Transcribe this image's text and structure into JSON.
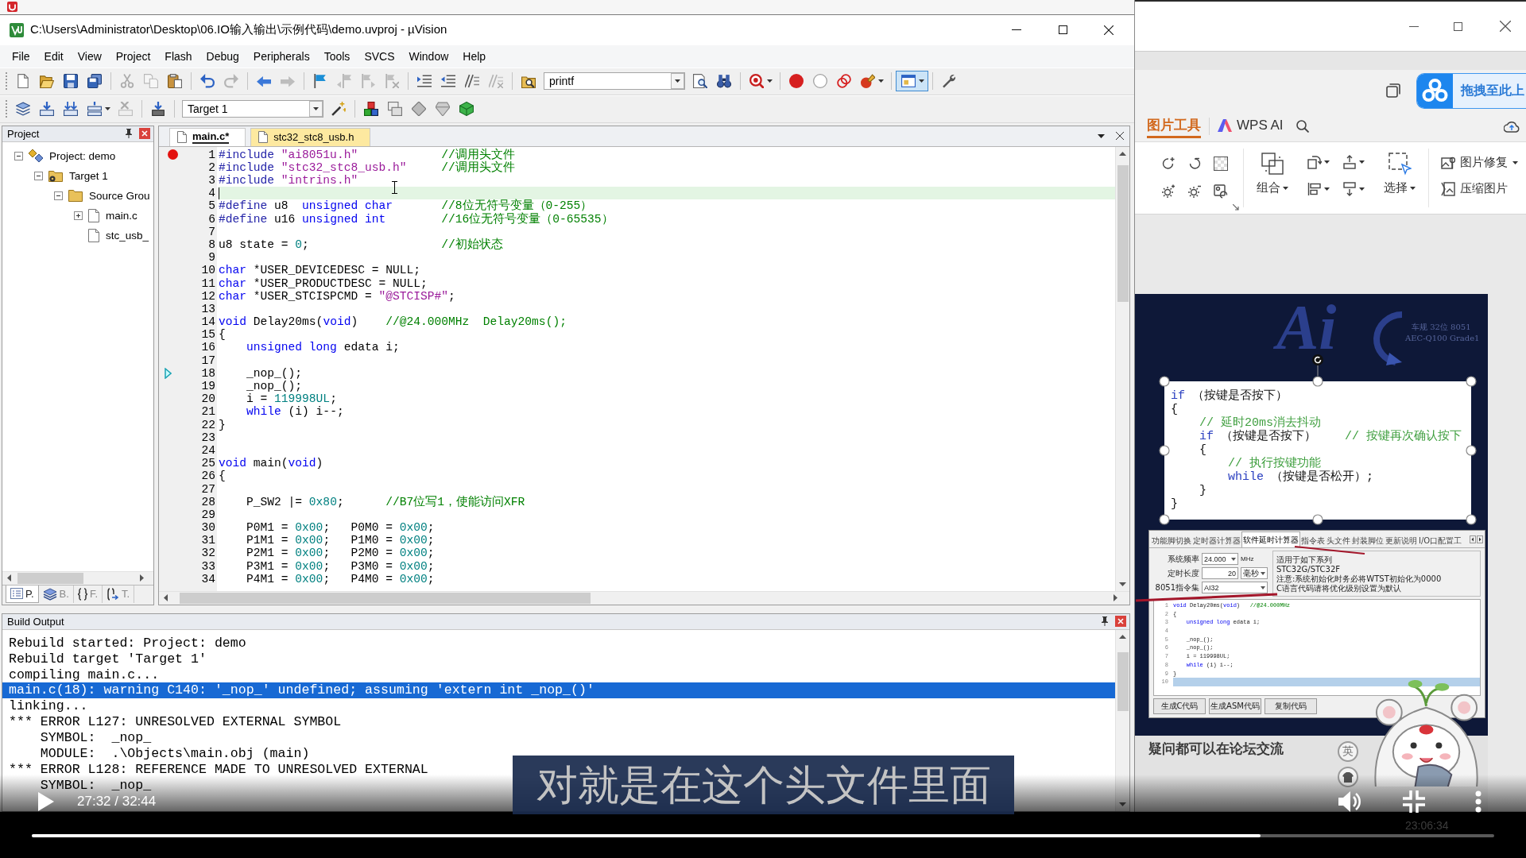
{
  "uvision": {
    "title": "C:\\Users\\Administrator\\Desktop\\06.IO输入输出\\示例代码\\demo.uvproj - µVision",
    "menu": [
      "File",
      "Edit",
      "View",
      "Project",
      "Flash",
      "Debug",
      "Peripherals",
      "Tools",
      "SVCS",
      "Window",
      "Help"
    ],
    "toolbars": [
      {
        "items": [
          {
            "kind": "new-file",
            "disabled": false
          },
          {
            "kind": "open",
            "disabled": false
          },
          {
            "kind": "save",
            "disabled": false
          },
          {
            "kind": "save-all",
            "disabled": false
          },
          {
            "kind": "separator"
          },
          {
            "kind": "cut",
            "disabled": true
          },
          {
            "kind": "copy",
            "disabled": true
          },
          {
            "kind": "paste",
            "disabled": false
          },
          {
            "kind": "separator"
          },
          {
            "kind": "undo",
            "disabled": false
          },
          {
            "kind": "redo",
            "disabled": true
          },
          {
            "kind": "separator"
          },
          {
            "kind": "back",
            "disabled": false
          },
          {
            "kind": "forward",
            "disabled": true
          },
          {
            "kind": "separator"
          },
          {
            "kind": "bookmark",
            "disabled": false
          },
          {
            "kind": "prev-bookmark",
            "disabled": true
          },
          {
            "kind": "next-bookmark",
            "disabled": true
          },
          {
            "kind": "clear-bookmarks",
            "disabled": true
          },
          {
            "kind": "separator"
          },
          {
            "kind": "indent",
            "disabled": false
          },
          {
            "kind": "unindent",
            "disabled": false
          },
          {
            "kind": "comment",
            "disabled": false
          },
          {
            "kind": "uncomment",
            "disabled": true
          },
          {
            "kind": "separator"
          },
          {
            "kind": "find-files",
            "disabled": false
          },
          {
            "kind": "combo",
            "value": "printf"
          },
          {
            "kind": "find",
            "disabled": false
          },
          {
            "kind": "incremental-find",
            "disabled": false
          },
          {
            "kind": "separator"
          },
          {
            "kind": "debug",
            "disabled": false,
            "dropdown": true
          },
          {
            "kind": "separator"
          },
          {
            "kind": "breakpoint",
            "disabled": false
          },
          {
            "kind": "breakpoint-enable",
            "disabled": false
          },
          {
            "kind": "breakpoints-disable",
            "disabled": false
          },
          {
            "kind": "breakpoints-kill",
            "disabled": false,
            "dropdown": true
          },
          {
            "kind": "separator"
          },
          {
            "kind": "layout",
            "disabled": false,
            "dropdown": true,
            "pressed": true
          },
          {
            "kind": "separator"
          },
          {
            "kind": "configure",
            "disabled": false
          }
        ]
      },
      {
        "items": [
          {
            "kind": "translate",
            "disabled": false
          },
          {
            "kind": "build",
            "disabled": false
          },
          {
            "kind": "rebuild",
            "disabled": false
          },
          {
            "kind": "batch-build",
            "disabled": false,
            "dropdown": true
          },
          {
            "kind": "stop-build",
            "disabled": true
          },
          {
            "kind": "separator"
          },
          {
            "kind": "download",
            "disabled": false
          },
          {
            "kind": "separator"
          },
          {
            "kind": "combo",
            "value": "Target 1"
          },
          {
            "kind": "target-options",
            "disabled": false
          },
          {
            "kind": "separator"
          },
          {
            "kind": "manage-items",
            "disabled": false
          },
          {
            "kind": "components",
            "disabled": false
          },
          {
            "kind": "select-packs",
            "disabled": false
          },
          {
            "kind": "pack-tools",
            "disabled": false
          },
          {
            "kind": "pack-installer",
            "disabled": false
          }
        ]
      }
    ],
    "project": {
      "title": "Project",
      "tree": [
        {
          "label": "Project: demo",
          "kind": "project",
          "expanded": true,
          "children": [
            {
              "label": "Target 1",
              "kind": "target",
              "expanded": true,
              "children": [
                {
                  "label": "Source Grou",
                  "kind": "folder",
                  "expanded": true,
                  "children": [
                    {
                      "label": "main.c",
                      "kind": "file",
                      "expanded": false
                    },
                    {
                      "label": "stc_usb_",
                      "kind": "file"
                    }
                  ]
                }
              ]
            }
          ]
        }
      ],
      "tabs": [
        {
          "label": "P.",
          "kind": "project",
          "selected": true
        },
        {
          "label": "B.",
          "kind": "books",
          "selected": false
        },
        {
          "label": "F.",
          "kind": "functions",
          "selected": false
        },
        {
          "label": "T.",
          "kind": "templates",
          "selected": false
        }
      ]
    },
    "editor": {
      "tabs": [
        {
          "label": "main.c*",
          "selected": true
        },
        {
          "label": "stc32_stc8_usb.h",
          "selected": false
        }
      ],
      "lines": [
        {
          "number": "1",
          "kind": "breakpoint",
          "current": false,
          "tokens": [
            {
              "kind": "directive",
              "text": "#include"
            },
            {
              "kind": "string",
              "text": " \"ai8051u.h\""
            },
            {
              "kind": "comment",
              "text": "            //调用头文件"
            }
          ]
        },
        {
          "number": "2",
          "kind": "plain",
          "current": false,
          "tokens": [
            {
              "kind": "directive",
              "text": "#include"
            },
            {
              "kind": "string",
              "text": " \"stc32_stc8_usb.h\""
            },
            {
              "kind": "comment",
              "text": "     //调用头文件"
            }
          ]
        },
        {
          "number": "3",
          "kind": "plain",
          "current": false,
          "tokens": [
            {
              "kind": "directive",
              "text": "#include"
            },
            {
              "kind": "string",
              "text": " \"intrins.h\""
            }
          ]
        },
        {
          "number": "4",
          "kind": "plain",
          "current": true
        },
        {
          "number": "5",
          "kind": "plain",
          "current": false,
          "tokens": [
            {
              "kind": "directive",
              "text": "#define"
            },
            {
              "kind": "plain",
              "text": " u8  "
            },
            {
              "kind": "keyword",
              "text": "unsigned char"
            },
            {
              "kind": "comment",
              "text": "       //8位无符号变量（0-255）"
            }
          ]
        },
        {
          "number": "6",
          "kind": "plain",
          "current": false,
          "tokens": [
            {
              "kind": "directive",
              "text": "#define"
            },
            {
              "kind": "plain",
              "text": " u16 "
            },
            {
              "kind": "keyword",
              "text": "unsigned int"
            },
            {
              "kind": "comment",
              "text": "        //16位无符号变量（0-65535）"
            }
          ]
        },
        {
          "number": "7",
          "kind": "plain",
          "current": false
        },
        {
          "number": "8",
          "kind": "plain",
          "current": false,
          "tokens": [
            {
              "kind": "plain",
              "text": "u8 state = "
            },
            {
              "kind": "number",
              "text": "0"
            },
            {
              "kind": "plain",
              "text": ";"
            },
            {
              "kind": "comment",
              "text": "                   //初始状态"
            }
          ]
        },
        {
          "number": "9",
          "kind": "plain",
          "current": false
        },
        {
          "number": "10",
          "kind": "plain",
          "current": false,
          "tokens": [
            {
              "kind": "keyword",
              "text": "char"
            },
            {
              "kind": "plain",
              "text": " *USER_DEVICEDESC = NULL;"
            }
          ]
        },
        {
          "number": "11",
          "kind": "plain",
          "current": false,
          "tokens": [
            {
              "kind": "keyword",
              "text": "char"
            },
            {
              "kind": "plain",
              "text": " *USER_PRODUCTDESC = NULL;"
            }
          ]
        },
        {
          "number": "12",
          "kind": "plain",
          "current": false,
          "tokens": [
            {
              "kind": "keyword",
              "text": "char"
            },
            {
              "kind": "plain",
              "text": " *USER_STCISPCMD = "
            },
            {
              "kind": "string",
              "text": "\"@STCISP#\""
            },
            {
              "kind": "plain",
              "text": ";"
            }
          ]
        },
        {
          "number": "13",
          "kind": "plain",
          "current": false
        },
        {
          "number": "14",
          "kind": "plain",
          "current": false,
          "tokens": [
            {
              "kind": "keyword",
              "text": "void"
            },
            {
              "kind": "plain",
              "text": " Delay20ms("
            },
            {
              "kind": "keyword",
              "text": "void"
            },
            {
              "kind": "plain",
              "text": ")"
            },
            {
              "kind": "comment",
              "text": "    //@24.000MHz  Delay20ms();"
            }
          ]
        },
        {
          "number": "15",
          "kind": "plain",
          "current": false,
          "tokens": [
            {
              "kind": "plain",
              "text": "{"
            }
          ]
        },
        {
          "number": "16",
          "kind": "plain",
          "current": false,
          "tokens": [
            {
              "kind": "keyword",
              "text": "    unsigned long"
            },
            {
              "kind": "plain",
              "text": " edata i;"
            }
          ]
        },
        {
          "number": "17",
          "kind": "plain",
          "current": false
        },
        {
          "number": "18",
          "kind": "pointer",
          "current": false,
          "tokens": [
            {
              "kind": "plain",
              "text": "    _nop_();"
            }
          ]
        },
        {
          "number": "19",
          "kind": "plain",
          "current": false,
          "tokens": [
            {
              "kind": "plain",
              "text": "    _nop_();"
            }
          ]
        },
        {
          "number": "20",
          "kind": "plain",
          "current": false,
          "tokens": [
            {
              "kind": "plain",
              "text": "    i = "
            },
            {
              "kind": "number",
              "text": "119998UL"
            },
            {
              "kind": "plain",
              "text": ";"
            }
          ]
        },
        {
          "number": "21",
          "kind": "plain",
          "current": false,
          "tokens": [
            {
              "kind": "keyword",
              "text": "    while"
            },
            {
              "kind": "plain",
              "text": " (i) i--;"
            }
          ]
        },
        {
          "number": "22",
          "kind": "plain",
          "current": false,
          "tokens": [
            {
              "kind": "plain",
              "text": "}"
            }
          ]
        },
        {
          "number": "23",
          "kind": "plain",
          "current": false
        },
        {
          "number": "24",
          "kind": "plain",
          "current": false
        },
        {
          "number": "25",
          "kind": "plain",
          "current": false,
          "tokens": [
            {
              "kind": "keyword",
              "text": "void"
            },
            {
              "kind": "plain",
              "text": " main("
            },
            {
              "kind": "keyword",
              "text": "void"
            },
            {
              "kind": "plain",
              "text": ")"
            }
          ]
        },
        {
          "number": "26",
          "kind": "plain",
          "current": false,
          "tokens": [
            {
              "kind": "plain",
              "text": "{"
            }
          ]
        },
        {
          "number": "27",
          "kind": "plain",
          "current": false
        },
        {
          "number": "28",
          "kind": "plain",
          "current": false,
          "tokens": [
            {
              "kind": "plain",
              "text": "    P_SW2 |= "
            },
            {
              "kind": "number",
              "text": "0x80"
            },
            {
              "kind": "plain",
              "text": ";"
            },
            {
              "kind": "comment",
              "text": "      //B7位写1，使能访问XFR"
            }
          ]
        },
        {
          "number": "29",
          "kind": "plain",
          "current": false
        },
        {
          "number": "30",
          "kind": "plain",
          "current": false,
          "tokens": [
            {
              "kind": "plain",
              "text": "    P0M1 = "
            },
            {
              "kind": "number",
              "text": "0x00"
            },
            {
              "kind": "plain",
              "text": ";   P0M0 = "
            },
            {
              "kind": "number",
              "text": "0x00"
            },
            {
              "kind": "plain",
              "text": ";"
            }
          ]
        },
        {
          "number": "31",
          "kind": "plain",
          "current": false,
          "tokens": [
            {
              "kind": "plain",
              "text": "    P1M1 = "
            },
            {
              "kind": "number",
              "text": "0x00"
            },
            {
              "kind": "plain",
              "text": ";   P1M0 = "
            },
            {
              "kind": "number",
              "text": "0x00"
            },
            {
              "kind": "plain",
              "text": ";"
            }
          ]
        },
        {
          "number": "32",
          "kind": "plain",
          "current": false,
          "tokens": [
            {
              "kind": "plain",
              "text": "    P2M1 = "
            },
            {
              "kind": "number",
              "text": "0x00"
            },
            {
              "kind": "plain",
              "text": ";   P2M0 = "
            },
            {
              "kind": "number",
              "text": "0x00"
            },
            {
              "kind": "plain",
              "text": ";"
            }
          ]
        },
        {
          "number": "33",
          "kind": "plain",
          "current": false,
          "tokens": [
            {
              "kind": "plain",
              "text": "    P3M1 = "
            },
            {
              "kind": "number",
              "text": "0x00"
            },
            {
              "kind": "plain",
              "text": ";   P3M0 = "
            },
            {
              "kind": "number",
              "text": "0x00"
            },
            {
              "kind": "plain",
              "text": ";"
            }
          ]
        },
        {
          "number": "34",
          "kind": "plain",
          "current": false,
          "tokens": [
            {
              "kind": "plain",
              "text": "    P4M1 = "
            },
            {
              "kind": "number",
              "text": "0x00"
            },
            {
              "kind": "plain",
              "text": ";   P4M0 = "
            },
            {
              "kind": "number",
              "text": "0x00"
            },
            {
              "kind": "plain",
              "text": ";"
            }
          ]
        }
      ]
    },
    "build_output": {
      "title": "Build Output",
      "lines": [
        {
          "text": "Rebuild started: Project: demo",
          "selected": false
        },
        {
          "text": "Rebuild target 'Target 1'",
          "selected": false
        },
        {
          "text": "compiling main.c...",
          "selected": false
        },
        {
          "text": "main.c(18): warning C140: '_nop_' undefined; assuming 'extern int _nop_()'",
          "selected": true
        },
        {
          "text": "linking...",
          "selected": false
        },
        {
          "text": "*** ERROR L127: UNRESOLVED EXTERNAL SYMBOL",
          "selected": false
        },
        {
          "text": "    SYMBOL:  _nop_",
          "selected": false
        },
        {
          "text": "    MODULE:  .\\Objects\\main.obj (main)",
          "selected": false
        },
        {
          "text": "*** ERROR L128: REFERENCE MADE TO UNRESOLVED EXTERNAL",
          "selected": false
        },
        {
          "text": "    SYMBOL:  _nop_",
          "selected": false
        }
      ]
    }
  },
  "wps": {
    "upload_label": "拖拽至此上",
    "tabs": [
      {
        "label": "图片工具",
        "kind": "text",
        "selected": true
      },
      {
        "label": "WPS AI",
        "kind": "ai",
        "selected": false
      }
    ],
    "ribbon": {
      "combine": "组合",
      "select": "选择",
      "repair": "图片修复",
      "compress": "压缩图片"
    },
    "slide": {
      "logo": "Ai",
      "captions": [
        "车规 32位 8051",
        "AEC-Q100 Grade1"
      ],
      "code": [
        {
          "tokens": [
            {
              "kind": "keyword",
              "text": "if"
            },
            {
              "kind": "plain",
              "text": " （按键是否按下）"
            }
          ]
        },
        {
          "tokens": [
            {
              "kind": "plain",
              "text": "{"
            }
          ]
        },
        {
          "tokens": [
            {
              "kind": "comment",
              "text": "    // 延时20ms消去抖动"
            }
          ]
        },
        {
          "tokens": [
            {
              "kind": "keyword",
              "text": "    if"
            },
            {
              "kind": "plain",
              "text": " （按键是否按下）"
            },
            {
              "kind": "comment",
              "text": "    // 按键再次确认按下"
            }
          ]
        },
        {
          "tokens": [
            {
              "kind": "plain",
              "text": "    {"
            }
          ]
        },
        {
          "tokens": [
            {
              "kind": "comment",
              "text": "        // 执行按键功能"
            }
          ]
        },
        {
          "tokens": [
            {
              "kind": "keyword",
              "text": "        while"
            },
            {
              "kind": "plain",
              "text": " （按键是否松开）;"
            }
          ]
        },
        {
          "tokens": [
            {
              "kind": "plain",
              "text": "    }"
            }
          ]
        },
        {
          "tokens": [
            {
              "kind": "plain",
              "text": "}"
            }
          ]
        }
      ],
      "dialog": {
        "tabs": [
          {
            "label": "功能脚切换",
            "selected": false
          },
          {
            "label": "定时器计算器",
            "selected": false
          },
          {
            "label": "软件延时计算器",
            "selected": true
          },
          {
            "label": "指令表",
            "selected": false
          },
          {
            "label": "头文件",
            "selected": false
          },
          {
            "label": "封装脚位",
            "selected": false
          },
          {
            "label": "更新说明",
            "selected": false
          },
          {
            "label": "I/O口配置工",
            "selected": false
          }
        ],
        "fields": [
          {
            "label": "系统频率",
            "value": "24.000",
            "kind": "combo",
            "unit": {
              "kind": "label",
              "text": "MHz"
            }
          },
          {
            "label": "定时长度",
            "value": "20",
            "kind": "input",
            "unit": {
              "kind": "combo",
              "text": "毫秒"
            }
          },
          {
            "label": "8051指令集",
            "value": "AI32",
            "kind": "wide-combo"
          }
        ],
        "notes": [
          "适用于如下系列",
          "STC32G/STC32F",
          "注意:系统初始化时务必将WTST初始化为0000",
          "C语言代码请将优化级别设置为默认"
        ],
        "code": [
          {
            "number": "1",
            "selected": false,
            "tokens": [
              {
                "kind": "keyword",
                "text": "void"
              },
              {
                "kind": "plain",
                "text": " Delay20ms("
              },
              {
                "kind": "keyword",
                "text": "void"
              },
              {
                "kind": "plain",
                "text": ")"
              },
              {
                "kind": "comment",
                "text": "   //@24.000MHz"
              }
            ]
          },
          {
            "number": "2",
            "selected": false,
            "tokens": [
              {
                "kind": "plain",
                "text": "{"
              }
            ]
          },
          {
            "number": "3",
            "selected": false,
            "tokens": [
              {
                "kind": "keyword",
                "text": "    unsigned long"
              },
              {
                "kind": "plain",
                "text": " edata i;"
              }
            ]
          },
          {
            "number": "4",
            "selected": false
          },
          {
            "number": "5",
            "selected": false,
            "tokens": [
              {
                "kind": "plain",
                "text": "    _nop_();"
              }
            ]
          },
          {
            "number": "6",
            "selected": false,
            "tokens": [
              {
                "kind": "plain",
                "text": "    _nop_();"
              }
            ]
          },
          {
            "number": "7",
            "selected": false,
            "tokens": [
              {
                "kind": "plain",
                "text": "    i = 119998UL;"
              }
            ]
          },
          {
            "number": "8",
            "selected": false,
            "tokens": [
              {
                "kind": "keyword",
                "text": "    while"
              },
              {
                "kind": "plain",
                "text": " (i) i--;"
              }
            ]
          },
          {
            "number": "9",
            "selected": false,
            "tokens": [
              {
                "kind": "plain",
                "text": "}"
              }
            ]
          },
          {
            "number": "10",
            "selected": true
          }
        ],
        "buttons": [
          "生成C代码",
          "生成ASM代码",
          "复制代码"
        ]
      },
      "footer": "疑问都可以在论坛交流",
      "badge": "英"
    }
  },
  "video": {
    "subtitle": "对就是在这个头文件里面",
    "playing": false,
    "time": "27:32 / 32:44",
    "muted": false,
    "fullscreen": true,
    "level": 0.84
  },
  "taskbar": {
    "clock": "23:06:34"
  }
}
